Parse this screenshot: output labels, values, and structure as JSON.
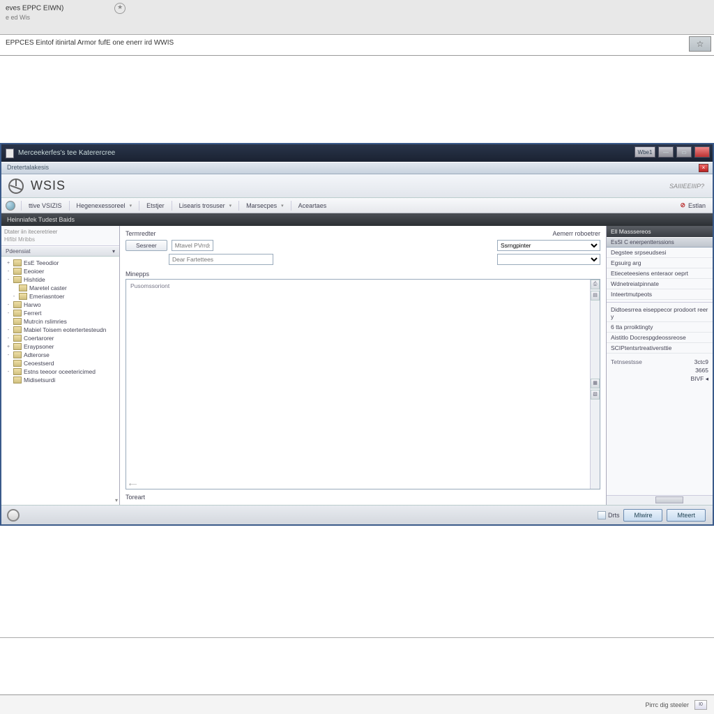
{
  "outer": {
    "title_top": "eves EPPC EIWN)",
    "title_sub": "e ed Wis",
    "tab_label": "EPPCES Eintof itinirtal Armor fufE one enerr ird WWIS",
    "bottom_status": "Pirrc dig steeler",
    "bottom_code": "I0"
  },
  "titlebar": {
    "title": "Merceekerfes's tee Katerercree",
    "badge": "Wbe1"
  },
  "subtitle": "Dretertalakesis",
  "brand": {
    "title": "WSIS",
    "right": "SAIIIEEIIIP?"
  },
  "menu": {
    "items": [
      "ttive VSIZIS",
      "Hegenexessoreel",
      "Etstjer",
      "Lisearis trosuser",
      "Marsecpes",
      "Aceartaes"
    ],
    "right_label": "Estlan"
  },
  "darkband": {
    "left": "Heinniafek  Tudest Baids",
    "right": "Ell Masssereos"
  },
  "sidebar": {
    "search_label": "Dtater iin iteceretrieer",
    "search_sub": "Hifibl Mribbs",
    "section_head": "Pdeensiat",
    "tree": [
      {
        "exp": "+",
        "label": "EsE Teeodior",
        "level": 0
      },
      {
        "exp": "-",
        "label": "Eeoioer",
        "level": 0
      },
      {
        "exp": "-",
        "label": "Hishtide",
        "level": 0
      },
      {
        "exp": "",
        "label": "Maretel caster",
        "level": 1
      },
      {
        "exp": "-",
        "label": "Emeriasntoer",
        "level": 1
      },
      {
        "exp": "-",
        "label": "Harwo",
        "level": 0
      },
      {
        "exp": "-",
        "label": "Ferrert",
        "level": 0
      },
      {
        "exp": "",
        "label": "Mutrcin rslimries",
        "level": 0
      },
      {
        "exp": "-",
        "label": "Mabiel Toisem eotertertesteudn",
        "level": 0
      },
      {
        "exp": "-",
        "label": "Coertarorer",
        "level": 0
      },
      {
        "exp": "+",
        "label": "Eraypsoner",
        "level": 0
      },
      {
        "exp": "-",
        "label": "Adterorse",
        "level": 0
      },
      {
        "exp": "",
        "label": "Ceoestserd",
        "level": 0
      },
      {
        "exp": "-",
        "label": "Estns teeoor oceetericimed",
        "level": 0
      },
      {
        "exp": "",
        "label": "Midisetsurdi",
        "level": 0
      }
    ]
  },
  "center": {
    "top_label_left": "Termredter",
    "top_label_right": "Aemerr roboetrer",
    "btn_search": "Sesreer",
    "input1_label": "Mtavel PVrrds",
    "input2_label": "Dear Fartettees",
    "select_placeholder": "Ssrngpinter",
    "section_lbl": "Minepps",
    "ta_label": "Pusomssoriont",
    "ta_corner": "⟵",
    "footer_lbl": "Toreart"
  },
  "right": {
    "head": "Ell Masssereos",
    "selected": "EsSI C enerpentterssions",
    "items": [
      "Degstee srpseudsesi",
      "Egsuirg arg",
      "Etieceteesiens enteraor oeprt",
      "Wdnetreiatpinnate",
      "Inteertmutpeots"
    ],
    "block2a": "Didtoesrrea eiseppecor prodoort reery",
    "block2b": "6 tta prroiktingty",
    "block3a": "Aistitlo Docrespgdeossreose",
    "block3b": "SCIPtentsrtreativersttie",
    "kv": [
      {
        "k": "Tetnsestsse",
        "v": "3ctc9"
      },
      {
        "k": "",
        "v": "3665"
      },
      {
        "k": "",
        "v": "BIVF ◂"
      }
    ]
  },
  "statusbar": {
    "text": "Drts",
    "btn1": "Mlwire",
    "btn2": "Mteert"
  }
}
